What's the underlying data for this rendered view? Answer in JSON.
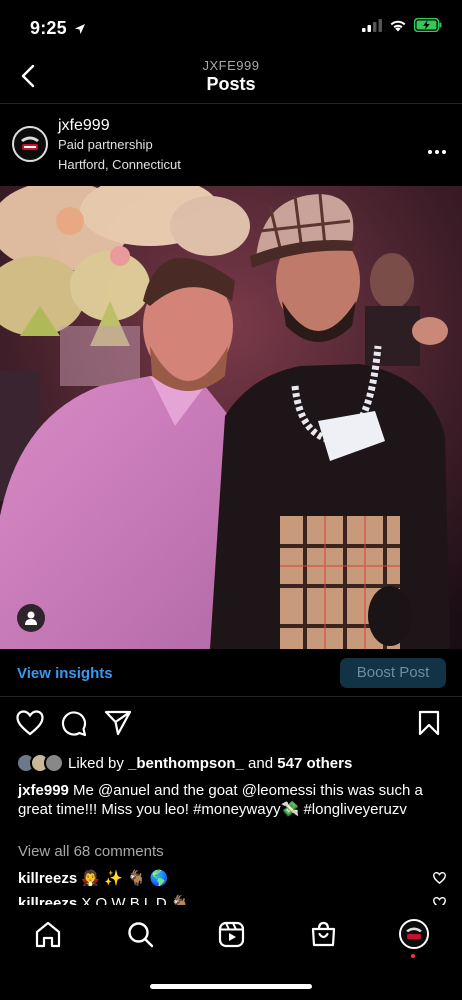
{
  "status": {
    "time": "9:25"
  },
  "header": {
    "account": "JXFE999",
    "title": "Posts"
  },
  "post": {
    "username": "jxfe999",
    "partnership": "Paid partnership",
    "location": "Hartford, Connecticut",
    "photo_caption_hidden": ""
  },
  "insights": {
    "view_label": "View insights",
    "boost_label": "Boost Post"
  },
  "likes": {
    "prefix": "Liked by ",
    "user": "_benthompson_",
    "middle": " and ",
    "others": "547 others"
  },
  "caption": {
    "username": "jxfe999",
    "text": " Me @anuel and the goat @leomessi this was such a great time!!! Miss you leo! #moneywayy💸 #longliveyeruzv"
  },
  "comments": {
    "view_all": "View all 68 comments",
    "items": [
      {
        "username": "killreezs",
        "text": " 🧛 ✨ 🐐 🌎"
      },
      {
        "username": "killreezs",
        "text": " X O W B L D  🐐"
      }
    ]
  },
  "icons": {
    "back": "chevron-left-icon",
    "more": "more-horizontal-icon",
    "like": "heart-icon",
    "comment": "comment-icon",
    "share": "send-icon",
    "save": "bookmark-icon",
    "home": "home-icon",
    "search": "search-icon",
    "reels": "reels-icon",
    "shop": "shop-icon",
    "tag": "user-tag-icon"
  },
  "colors": {
    "accent": "#3897f0",
    "boost_bg": "#123246",
    "battery": "#34c759",
    "notification": "#ff3040"
  }
}
